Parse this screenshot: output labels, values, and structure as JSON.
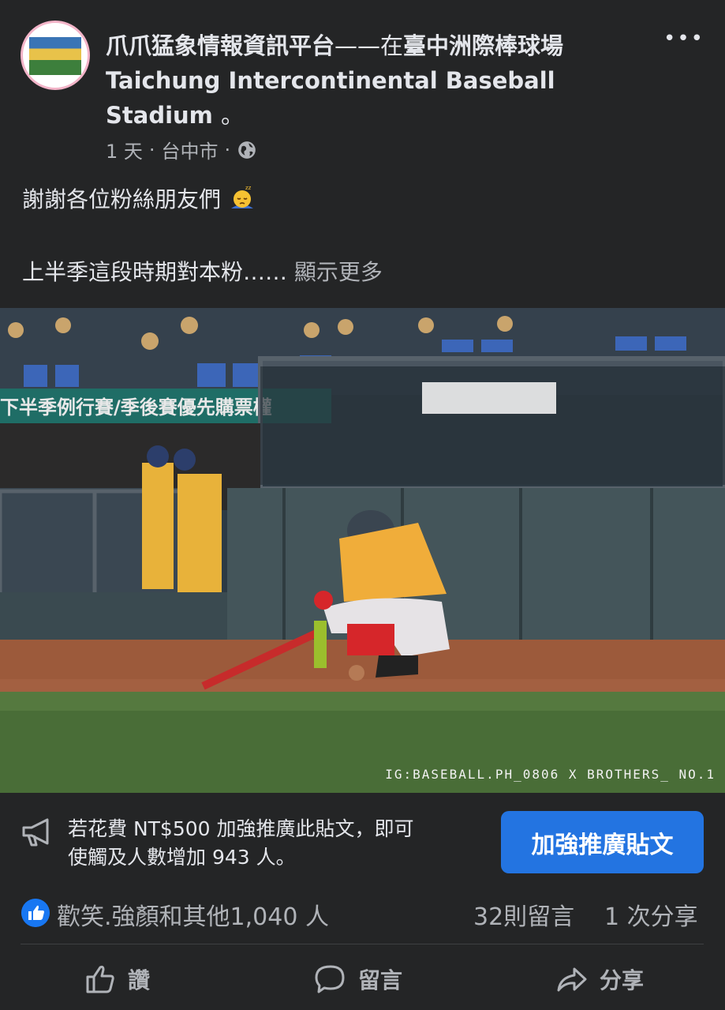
{
  "post": {
    "page_name": "爪爪猛象情報資訊平台",
    "title_connector": "——在",
    "location_name": "臺中洲際棒球場Taichung Intercontinental Baseball Stadium",
    "title_suffix": "。",
    "time": "1 天",
    "separator": "·",
    "place": "台中市",
    "privacy_icon": "globe-icon",
    "text_line1": "謝謝各位粉絲朋友們",
    "text_line1_emoji": "sleepy-face-emoji",
    "text_line2": "上半季這段時期對本粉……",
    "see_more": "顯示更多",
    "photo_watermark": "IG:BASEBALL.PH_0806 X BROTHERS_ NO.1"
  },
  "promo": {
    "icon": "megaphone-icon",
    "text_line1": "若花費 NT$500 加強推廣此貼文，即可",
    "text_line2": "使觸及人數增加 943 人。",
    "button_label": "加強推廣貼文"
  },
  "stats": {
    "reaction_icon": "like-reaction-icon",
    "likes": "歡笑.強顏和其他1,040 人",
    "comments": "32則留言",
    "shares": "1 次分享"
  },
  "actions": {
    "like_label": "讚",
    "comment_label": "留言",
    "share_label": "分享"
  },
  "colors": {
    "background": "#242526",
    "primary_text": "#e4e6eb",
    "secondary_text": "#b0b3b8",
    "accent": "#2374e1"
  }
}
